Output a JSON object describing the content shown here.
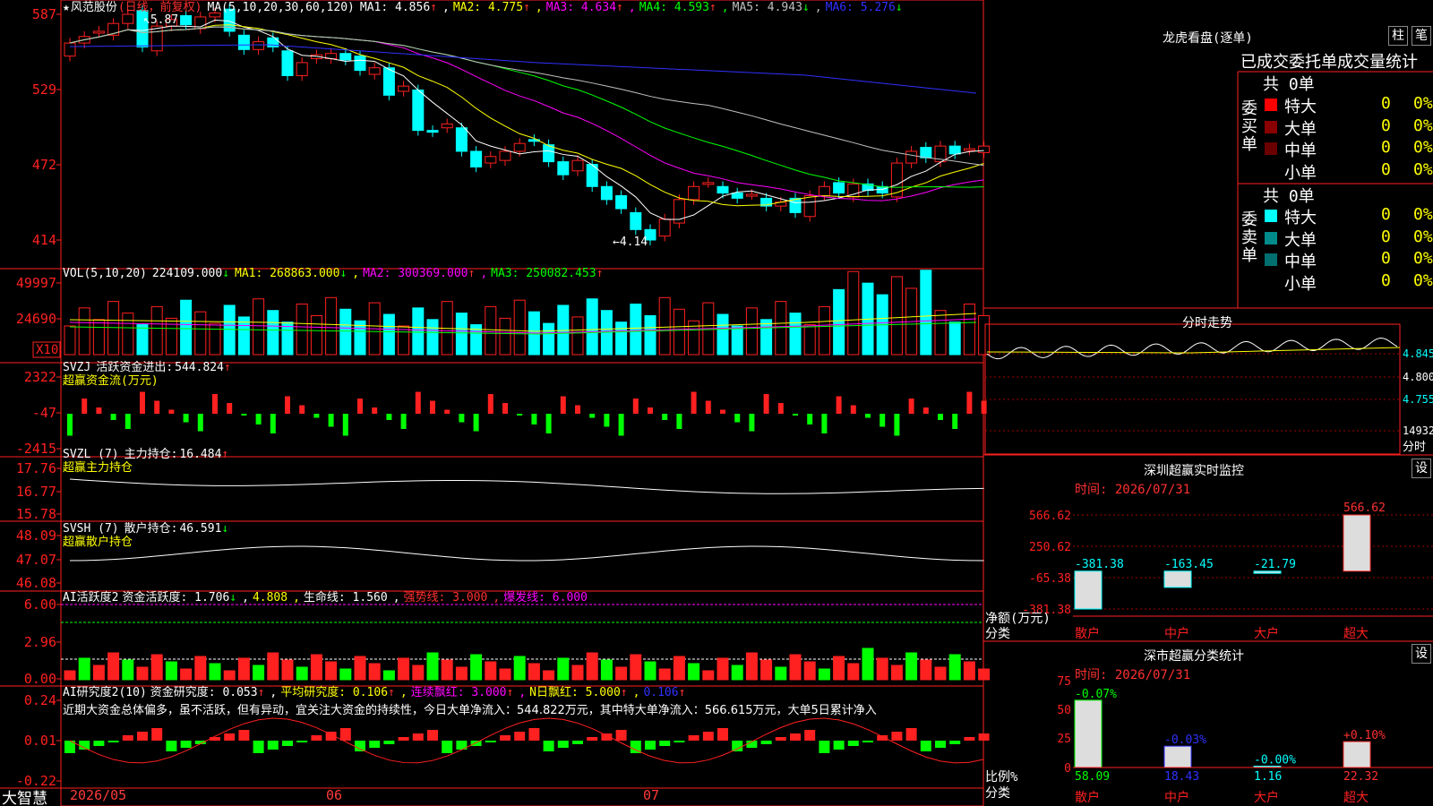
{
  "app": {
    "brand": "大智慧"
  },
  "main_header": {
    "star": "★",
    "stock_name": "风范股份",
    "period": "(日线，前复权)",
    "ma_label": "MA(5,10,20,30,60,120)",
    "ma_items": [
      {
        "label": "MA1:",
        "value": "4.856",
        "arrow": "↑",
        "color": "#ffffff"
      },
      {
        "label": "MA2:",
        "value": "4.775",
        "arrow": "↑",
        "color": "#ffff00"
      },
      {
        "label": "MA3:",
        "value": "4.634",
        "arrow": "↑",
        "color": "#ff00ff"
      },
      {
        "label": "MA4:",
        "value": "4.593",
        "arrow": "↑",
        "color": "#00ff00"
      },
      {
        "label": "MA5:",
        "value": "4.943",
        "arrow": "↓",
        "color": "#c0c0c0"
      },
      {
        "label": "MA6:",
        "value": "5.276",
        "arrow": "↓",
        "color": "#3030ff"
      }
    ],
    "high_marker": "5.87",
    "low_marker": "4.14"
  },
  "price_axis": [
    "587",
    "529",
    "472",
    "414"
  ],
  "vol_header": {
    "label": "VOL(5,10,20)",
    "value": "224109.000",
    "arrow": "↓",
    "items": [
      {
        "label": "MA1:",
        "value": "268863.000",
        "arrow": "↓",
        "color": "#ffff00"
      },
      {
        "label": "MA2:",
        "value": "300369.000",
        "arrow": "↑",
        "color": "#ff00ff"
      },
      {
        "label": "MA3:",
        "value": "250082.453",
        "arrow": "↑",
        "color": "#00ff00"
      }
    ]
  },
  "vol_axis": [
    "49997",
    "24690"
  ],
  "vol_unit": "X10",
  "svzj": {
    "label": "SVZJ",
    "text": "活跃资金进出:",
    "value": "544.824",
    "arrow": "↑",
    "sub": "超赢资金流(万元)",
    "axis": [
      "2322",
      "-47",
      "-2415"
    ]
  },
  "svzl": {
    "label": "SVZL (7)",
    "text": "主力持仓:",
    "value": "16.484",
    "arrow": "↑",
    "sub": "超赢主力持仓",
    "axis": [
      "17.76",
      "16.77",
      "15.78"
    ]
  },
  "svsh": {
    "label": "SVSH (7)",
    "text": "散户持仓:",
    "value": "46.591",
    "arrow": "↓",
    "sub": "超赢散户持仓",
    "axis": [
      "48.09",
      "47.07",
      "46.08"
    ]
  },
  "ai_active": {
    "label": "AI活跃度2",
    "items": [
      {
        "text": "资金活跃度:",
        "value": "1.706",
        "arrow": "↓",
        "color": "#ffffff"
      },
      {
        "text": "",
        "value": "4.808",
        "arrow": "",
        "color": "#ffff00"
      },
      {
        "text": "生命线:",
        "value": "1.560",
        "arrow": "",
        "color": "#ffffff"
      },
      {
        "text": "强势线:",
        "value": "3.000",
        "arrow": "",
        "color": "#ff3030"
      },
      {
        "text": "爆发线:",
        "value": "6.000",
        "arrow": "",
        "color": "#ff00ff"
      }
    ],
    "axis": [
      "6.00",
      "2.96",
      "0.00"
    ]
  },
  "ai_research": {
    "label": "AI研究度2(10)",
    "items": [
      {
        "text": "资金研究度:",
        "value": "0.053",
        "arrow": "↑",
        "color": "#ffffff"
      },
      {
        "text": "平均研究度:",
        "value": "0.106",
        "arrow": "↑",
        "color": "#ffff00"
      },
      {
        "text": "连续飘红:",
        "value": "3.000",
        "arrow": "↑",
        "color": "#ff00ff"
      },
      {
        "text": "N日飘红:",
        "value": "5.000",
        "arrow": "↑",
        "color": "#ffff00"
      },
      {
        "text": "",
        "value": "0.106",
        "arrow": "↑",
        "color": "#3030ff"
      }
    ],
    "note": "近期大资金总体偏多，虽不活跃，但有异动，宜关注大资金的持续性，今日大单净流入：544.822万元，其中特大单净流入：566.615万元，大单5日累计净入",
    "axis": [
      "0.24",
      "0.01",
      "-0.22"
    ]
  },
  "date_axis": [
    "2026/05",
    "06",
    "07"
  ],
  "longhu": {
    "title": "龙虎看盘(逐单)",
    "btn1": "柱",
    "btn2": "笔",
    "tabs": [
      "已成交",
      "委托单",
      "成交量统计"
    ],
    "buy_title": "委买单",
    "sell_title": "委卖单",
    "buy_total": "共 0单",
    "sell_total": "共 0单",
    "buy_rows": [
      {
        "label": "特大",
        "count": "0",
        "pct": "0%",
        "color": "#ff0000"
      },
      {
        "label": "大单",
        "count": "0",
        "pct": "0%",
        "color": "#8b0000"
      },
      {
        "label": "中单",
        "count": "0",
        "pct": "0%",
        "color": "#6a0000"
      },
      {
        "label": "小单",
        "count": "0",
        "pct": "0%",
        "color": ""
      }
    ],
    "sell_rows": [
      {
        "label": "特大",
        "count": "0",
        "pct": "0%",
        "color": "#00ffff"
      },
      {
        "label": "大单",
        "count": "0",
        "pct": "0%",
        "color": "#008b8b"
      },
      {
        "label": "中单",
        "count": "0",
        "pct": "0%",
        "color": "#006f6f"
      },
      {
        "label": "小单",
        "count": "0",
        "pct": "0%",
        "color": ""
      }
    ]
  },
  "intraday": {
    "title": "分时走势",
    "axis": [
      "4.845",
      "4.800",
      "4.755",
      "14932"
    ],
    "axis_last": "分时"
  },
  "sz_monitor": {
    "title": "深圳超赢实时监控",
    "btn": "设",
    "time": "时间: 2026/07/31",
    "axis": [
      "566.62",
      "250.62",
      "-65.38",
      "-381.38"
    ],
    "ylabel": [
      "净额(万元)",
      "分类"
    ],
    "chart_data": {
      "type": "bar",
      "categories": [
        "散户",
        "中户",
        "大户",
        "超大"
      ],
      "values": [
        -381.38,
        -163.45,
        -21.79,
        566.62
      ],
      "labels": [
        "-381.38",
        "-163.45",
        "-21.79",
        "566.62"
      ],
      "ylim": [
        -381.38,
        566.62
      ],
      "colors": [
        "#00ffff",
        "#00ffff",
        "#00ffff",
        "#ff3030"
      ]
    }
  },
  "sz_category": {
    "title": "深市超赢分类统计",
    "btn": "设",
    "time": "时间: 2026/07/31",
    "axis": [
      "75",
      "50",
      "25",
      "0"
    ],
    "ylabel": [
      "比例%",
      "分类"
    ],
    "chart_data": {
      "type": "bar",
      "categories": [
        "散户",
        "中户",
        "大户",
        "超大"
      ],
      "values": [
        58.09,
        18.43,
        1.16,
        22.32
      ],
      "bottom_labels": [
        "58.09",
        "18.43",
        "1.16",
        "22.32"
      ],
      "changes": [
        "-0.07%",
        "-0.03%",
        "-0.00%",
        "+0.10%"
      ],
      "ylim": [
        0,
        75
      ],
      "colors": [
        "#00ff00",
        "#3030ff",
        "#00ffff",
        "#ff3030"
      ]
    }
  }
}
